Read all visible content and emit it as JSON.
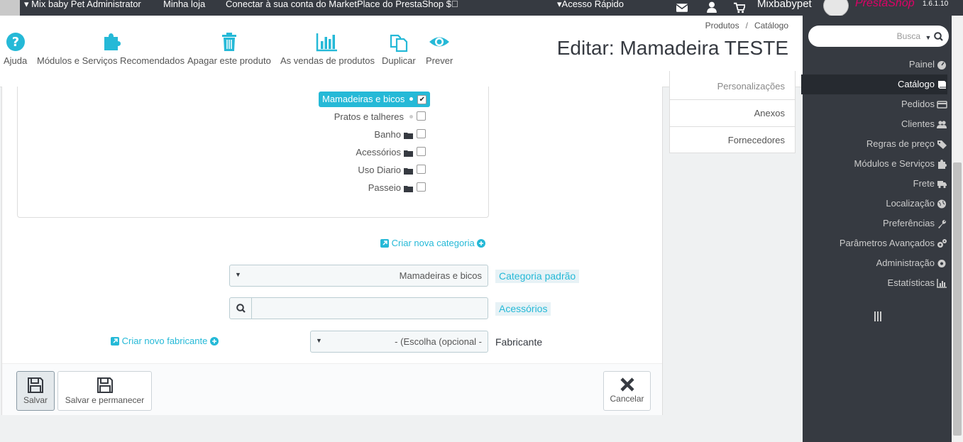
{
  "topbar": {
    "admin_name": "Mix baby Pet Administrator",
    "shop": "Minha loja",
    "marketplace": "Conectar à sua conta do MarketPlace do PrestaShop",
    "quick_access": "Acesso Rápido",
    "user": "Mixbabypet",
    "brand": "PrestaShop",
    "version": "1.6.1.10"
  },
  "toolbar": {
    "help": "Ajuda",
    "modules": "Módulos e Serviços Recomendados",
    "delete": "Apagar este produto",
    "sales": "As vendas de produtos",
    "duplicate": "Duplicar",
    "preview": "Prever"
  },
  "breadcrumb": {
    "first": "Produtos",
    "separator": "/",
    "second": "Catálogo"
  },
  "page_title": "Editar: Mamadeira TESTE",
  "search": {
    "placeholder": "Busca"
  },
  "sidebar": {
    "items": [
      {
        "label": "Painel",
        "icon": "dashboard-icon"
      },
      {
        "label": "Catálogo",
        "icon": "book-icon",
        "active": true
      },
      {
        "label": "Pedidos",
        "icon": "credit-card-icon"
      },
      {
        "label": "Clientes",
        "icon": "users-icon"
      },
      {
        "label": "Regras de preço",
        "icon": "tags-icon"
      },
      {
        "label": "Módulos e Serviços",
        "icon": "puzzle-icon"
      },
      {
        "label": "Frete",
        "icon": "truck-icon"
      },
      {
        "label": "Localização",
        "icon": "globe-icon"
      },
      {
        "label": "Preferências",
        "icon": "wrench-icon"
      },
      {
        "label": "Parâmetros Avançados",
        "icon": "cogs-icon"
      },
      {
        "label": "Administração",
        "icon": "cog-icon"
      },
      {
        "label": "Estatísticas",
        "icon": "bar-chart-icon"
      }
    ]
  },
  "right_tabs": {
    "partial": "Personalizações",
    "attachments": "Anexos",
    "suppliers": "Fornecedores"
  },
  "category_tree": {
    "selected": "Mamadeiras e bicos",
    "items": [
      "Pratos e talheres",
      "Banho",
      "Acessórios",
      "Uso Diario",
      "Passeio"
    ]
  },
  "links": {
    "new_category": "Criar nova categoria",
    "new_manufacturer": "Criar novo fabricante"
  },
  "default_category": {
    "value": "Mamadeiras e bicos",
    "label": "Categoria padrão"
  },
  "accessories": {
    "value": "",
    "label": "Acessórios"
  },
  "manufacturer": {
    "value": "- (Escolha (opcional -",
    "label": "Fabricante"
  },
  "footer": {
    "save": "Salvar",
    "save_stay": "Salvar e permanecer",
    "cancel": "Cancelar"
  },
  "colors": {
    "accent": "#25b9d7",
    "dark": "#363a41"
  }
}
